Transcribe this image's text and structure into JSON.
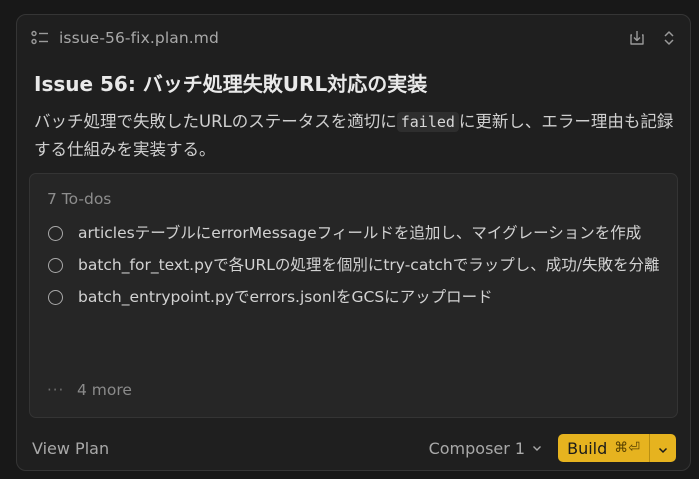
{
  "file": {
    "name": "issue-56-fix.plan.md",
    "icon": "list-icon"
  },
  "header_actions": {
    "download_icon": "download-icon",
    "expand_icon": "chevron-up-down-icon"
  },
  "plan": {
    "title": "Issue 56: バッチ処理失敗URL対応の実装",
    "desc_before": "バッチ処理で失敗したURLのステータスを適切に",
    "desc_code": "failed",
    "desc_after": "に更新し、エラー理由も記録する仕組みを実装する。"
  },
  "todos": {
    "count_label": "7 To-dos",
    "items": [
      {
        "text": "articlesテーブルにerrorMessageフィールドを追加し、マイグレーションを作成"
      },
      {
        "text": "batch_for_text.pyで各URLの処理を個別にtry-catchでラップし、成功/失敗を分離"
      },
      {
        "text": "batch_entrypoint.pyでerrors.jsonlをGCSにアップロード"
      }
    ],
    "more_ellipsis": "···",
    "more_label": "4 more"
  },
  "footer": {
    "view_plan_label": "View Plan",
    "model_label": "Composer 1",
    "build_label": "Build",
    "build_shortcut": "⌘⏎"
  },
  "colors": {
    "accent": "#e6b31f",
    "card_bg": "#1f1f1f",
    "todos_bg": "#262626"
  }
}
